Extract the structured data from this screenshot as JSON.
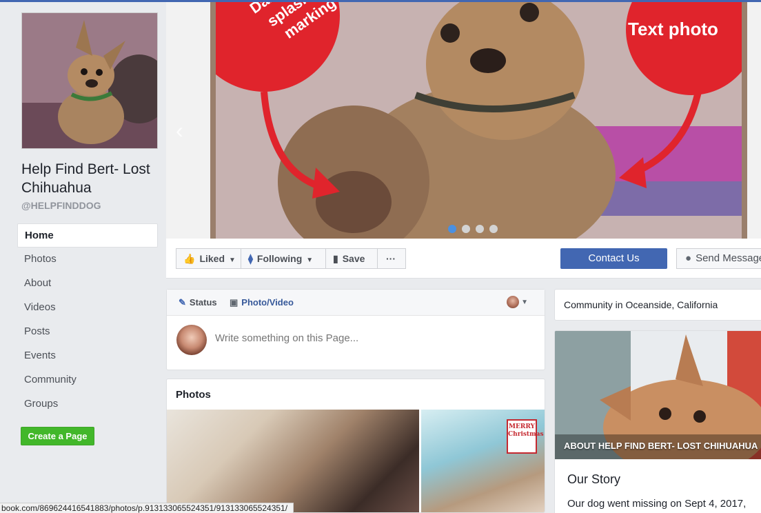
{
  "page": {
    "name": "Help Find Bert- Lost Chihuahua",
    "handle": "@HELPFINDDOG"
  },
  "nav": {
    "items": [
      {
        "label": "Home",
        "active": true
      },
      {
        "label": "Photos"
      },
      {
        "label": "About"
      },
      {
        "label": "Videos"
      },
      {
        "label": "Posts"
      },
      {
        "label": "Events"
      },
      {
        "label": "Community"
      },
      {
        "label": "Groups"
      }
    ],
    "create_page": "Create a Page"
  },
  "cover": {
    "badge_left": "Dark brown splashed marking",
    "badge_right": "Text photo",
    "slides": 4,
    "active_slide": 1
  },
  "actions": {
    "liked": "Liked",
    "following": "Following",
    "save": "Save",
    "more": "···",
    "contact": "Contact Us",
    "send_message": "Send Message"
  },
  "composer": {
    "status_tab": "Status",
    "photo_tab": "Photo/Video",
    "placeholder": "Write something on this Page..."
  },
  "photos": {
    "title": "Photos",
    "card_text": "MERRY Christmas"
  },
  "sidebar": {
    "community": "Community in Oceanside, California",
    "about_label": "ABOUT HELP FIND BERT- LOST CHIHUAHUA",
    "story_title": "Our Story",
    "story_text": "Our dog went missing on Sept 4, 2017,"
  },
  "status_bar": {
    "url": "book.com/869624416541883/photos/p.913133065524351/913133065524351/"
  },
  "colors": {
    "brand_blue": "#4267b2",
    "create_green": "#42b72a",
    "badge_red": "#e0242c",
    "dot_active": "#4a90e2"
  }
}
